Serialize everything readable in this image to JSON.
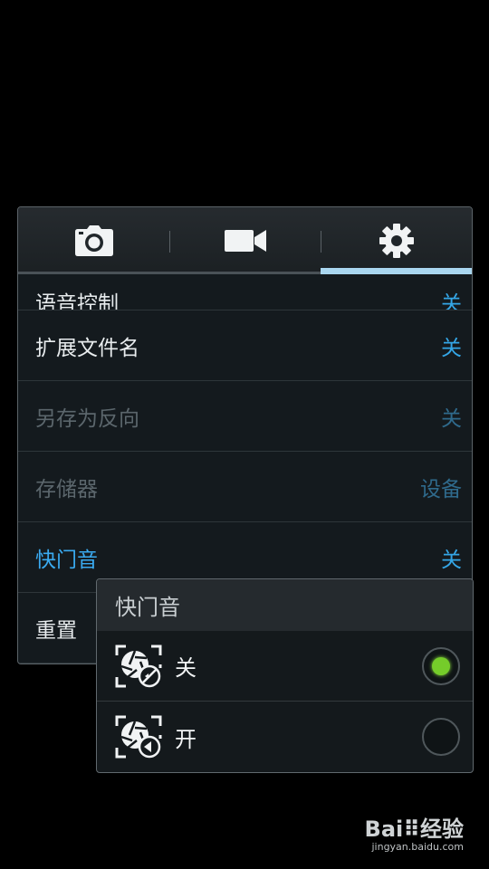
{
  "tabs": [
    {
      "name": "photo",
      "icon": "camera-icon",
      "active": false
    },
    {
      "name": "video",
      "icon": "video-camera-icon",
      "active": false
    },
    {
      "name": "settings",
      "icon": "gear-icon",
      "active": true
    }
  ],
  "settings": {
    "rows": [
      {
        "label": "语音控制",
        "value": "关",
        "state": "partial"
      },
      {
        "label": "扩展文件名",
        "value": "关",
        "state": "normal"
      },
      {
        "label": "另存为反向",
        "value": "关",
        "state": "disabled"
      },
      {
        "label": "存储器",
        "value": "设备",
        "state": "disabled"
      },
      {
        "label": "快门音",
        "value": "关",
        "state": "selected"
      },
      {
        "label": "重置",
        "value": "",
        "state": "normal"
      }
    ]
  },
  "popup": {
    "title": "快门音",
    "options": [
      {
        "label": "关",
        "icon": "shutter-sound-off-icon",
        "checked": true
      },
      {
        "label": "开",
        "icon": "shutter-sound-on-icon",
        "checked": false
      }
    ]
  },
  "watermark": {
    "logo": "Bai⠿经验",
    "url": "jingyan.baidu.com"
  },
  "colors": {
    "accent": "#34a6e6",
    "tab_active_indicator": "#a9d6ef",
    "radio_on": "#75cc2a",
    "background": "#000000",
    "panel": "#141a1e"
  }
}
